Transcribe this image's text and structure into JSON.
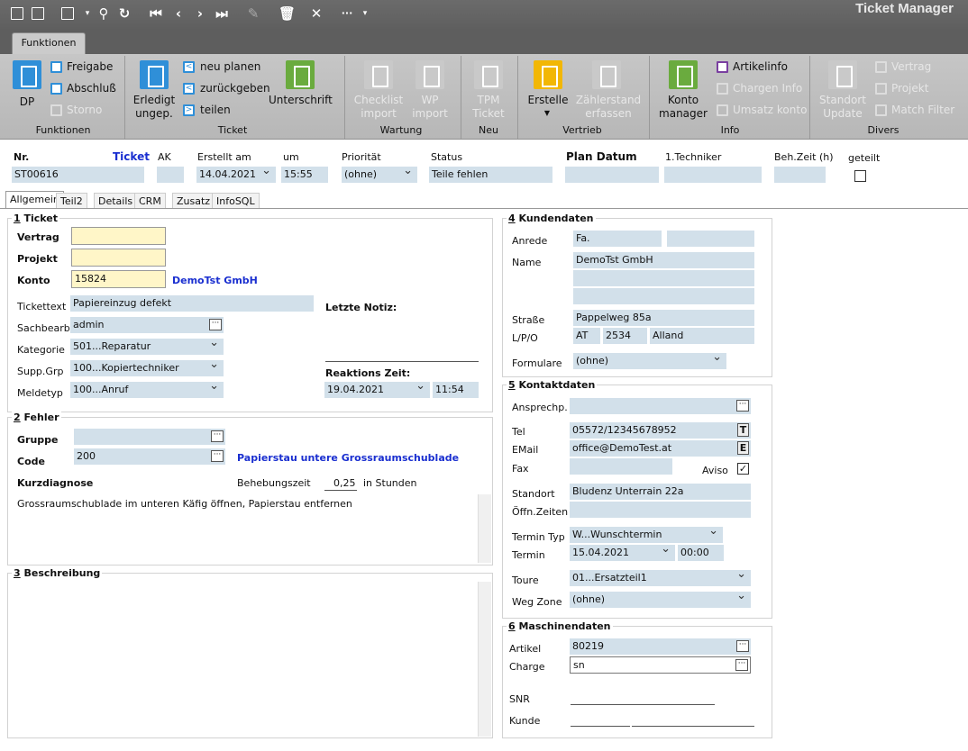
{
  "app_title": "Ticket Manager",
  "ribbon": {
    "tab": "Funktionen",
    "groups": {
      "funktionen": {
        "label": "Funktionen",
        "dp": "DP",
        "freigabe": "Freigabe",
        "abschluss": "Abschluß",
        "storno": "Storno"
      },
      "ticket": {
        "label": "Ticket",
        "erledigt1": "Erledigt",
        "erledigt2": "ungep.",
        "neu_planen": "neu planen",
        "zurueckgeben": "zurückgeben",
        "teilen": "teilen",
        "unterschrift": "Unterschrift"
      },
      "wartung": {
        "label": "Wartung",
        "checklist1": "Checklist",
        "checklist2": "import",
        "wp1": "WP",
        "wp2": "import"
      },
      "neu": {
        "label": "Neu",
        "tpm1": "TPM",
        "tpm2": "Ticket"
      },
      "vertrieb": {
        "label": "Vertrieb",
        "erstelle": "Erstelle",
        "zaehler1": "Zählerstand",
        "zaehler2": "erfassen"
      },
      "info": {
        "label": "Info",
        "konto1": "Konto",
        "konto2": "manager",
        "artikelinfo": "Artikelinfo",
        "chargen": "Chargen Info",
        "umsatz": "Umsatz konto"
      },
      "divers": {
        "label": "Divers",
        "standort1": "Standort",
        "standort2": "Update",
        "vertrag": "Vertrag",
        "projekt": "Projekt",
        "match": "Match Filter"
      }
    }
  },
  "header": {
    "nr_label": "Nr.",
    "nr_value": "ST00616",
    "ticket_label": "Ticket",
    "ak_label": "AK",
    "erstellt_label": "Erstellt am",
    "erstellt_value": "14.04.2021",
    "um_label": "um",
    "um_value": "15:55",
    "prio_label": "Priorität",
    "prio_value": "(ohne)",
    "status_label": "Status",
    "status_value": "Teile fehlen",
    "plan_label": "Plan Datum",
    "techniker_label": "1.Techniker",
    "behzeit_label": "Beh.Zeit (h)",
    "geteilt_label": "geteilt"
  },
  "tabs": [
    "Allgemein",
    "Teil2",
    "Details",
    "CRM",
    "Zusatz",
    "InfoSQL"
  ],
  "ticket": {
    "title_num": "1",
    "title": " Ticket",
    "vertrag_label": "Vertrag",
    "projekt_label": "Projekt",
    "konto_label": "Konto",
    "konto_value": "15824",
    "konto_name": "DemoTst GmbH",
    "tickettext_label": "Tickettext",
    "tickettext_value": "Papiereinzug defekt",
    "sachbearb_label": "Sachbearb.",
    "sachbearb_value": "admin",
    "kategorie_label": "Kategorie",
    "kategorie_value": "501...Reparatur",
    "suppgrp_label": "Supp.Grp",
    "suppgrp_value": "100...Kopiertechniker",
    "meldetyp_label": "Meldetyp",
    "meldetyp_value": "100...Anruf",
    "letzte_notiz_label": "Letzte Notiz:",
    "reaktion_label": "Reaktions Zeit:",
    "reaktion_date": "19.04.2021",
    "reaktion_time": "11:54"
  },
  "fehler": {
    "title_num": "2",
    "title": " Fehler",
    "gruppe_label": "Gruppe",
    "code_label": "Code",
    "code_value": "200",
    "code_desc": "Papierstau untere Grossraumschublade",
    "kurzdiagnose_label": "Kurzdiagnose",
    "behebung_label": "Behebungszeit",
    "behebung_value": "0,25",
    "behebung_unit": "in Stunden",
    "diagnose_text": "Grossraumschublade im unteren Käfig öffnen, Papierstau entfernen"
  },
  "beschreibung": {
    "title_num": "3",
    "title": " Beschreibung"
  },
  "kunde": {
    "title_num": "4",
    "title": " Kundendaten",
    "anrede_label": "Anrede",
    "anrede_value": "Fa.",
    "name_label": "Name",
    "name_value": "DemoTst GmbH",
    "strasse_label": "Straße",
    "strasse_value": "Pappelweg 85a",
    "lpo_label": "L/P/O",
    "land": "AT",
    "plz": "2534",
    "ort": "Alland",
    "formulare_label": "Formulare",
    "formulare_value": "(ohne)"
  },
  "kontakt": {
    "title_num": "5",
    "title": " Kontaktdaten",
    "ansprech_label": "Ansprechp.",
    "tel_label": "Tel",
    "tel_value": "05572/12345678952",
    "tel_btn": "T",
    "email_label": "EMail",
    "email_value": "office@DemoTest.at",
    "email_btn": "E",
    "fax_label": "Fax",
    "aviso_label": "Aviso",
    "aviso_check": "✓",
    "standort_label": "Standort",
    "standort_value": "Bludenz Unterrain 22a",
    "oeffn_label": "Öffn.Zeiten",
    "termintyp_label": "Termin Typ",
    "termintyp_value": "W...Wunschtermin",
    "termin_label": "Termin",
    "termin_date": "15.04.2021",
    "termin_time": "00:00",
    "toure_label": "Toure",
    "toure_value": "01...Ersatzteil1",
    "wegzone_label": "Weg Zone",
    "wegzone_value": "(ohne)"
  },
  "maschine": {
    "title_num": "6",
    "title": " Maschinendaten",
    "artikel_label": "Artikel",
    "artikel_value": "80219",
    "charge_label": "Charge",
    "charge_value": "sn",
    "snr_label": "SNR",
    "kunde_label": "Kunde"
  },
  "colors": {
    "field_bg": "#d2e0ea",
    "required_bg": "#fff6c8",
    "accent_blue": "#1a2fd0",
    "ribbon_blue": "#2f8fd8",
    "ribbon_yellow": "#f2b705",
    "ribbon_green": "#6aab3e"
  }
}
